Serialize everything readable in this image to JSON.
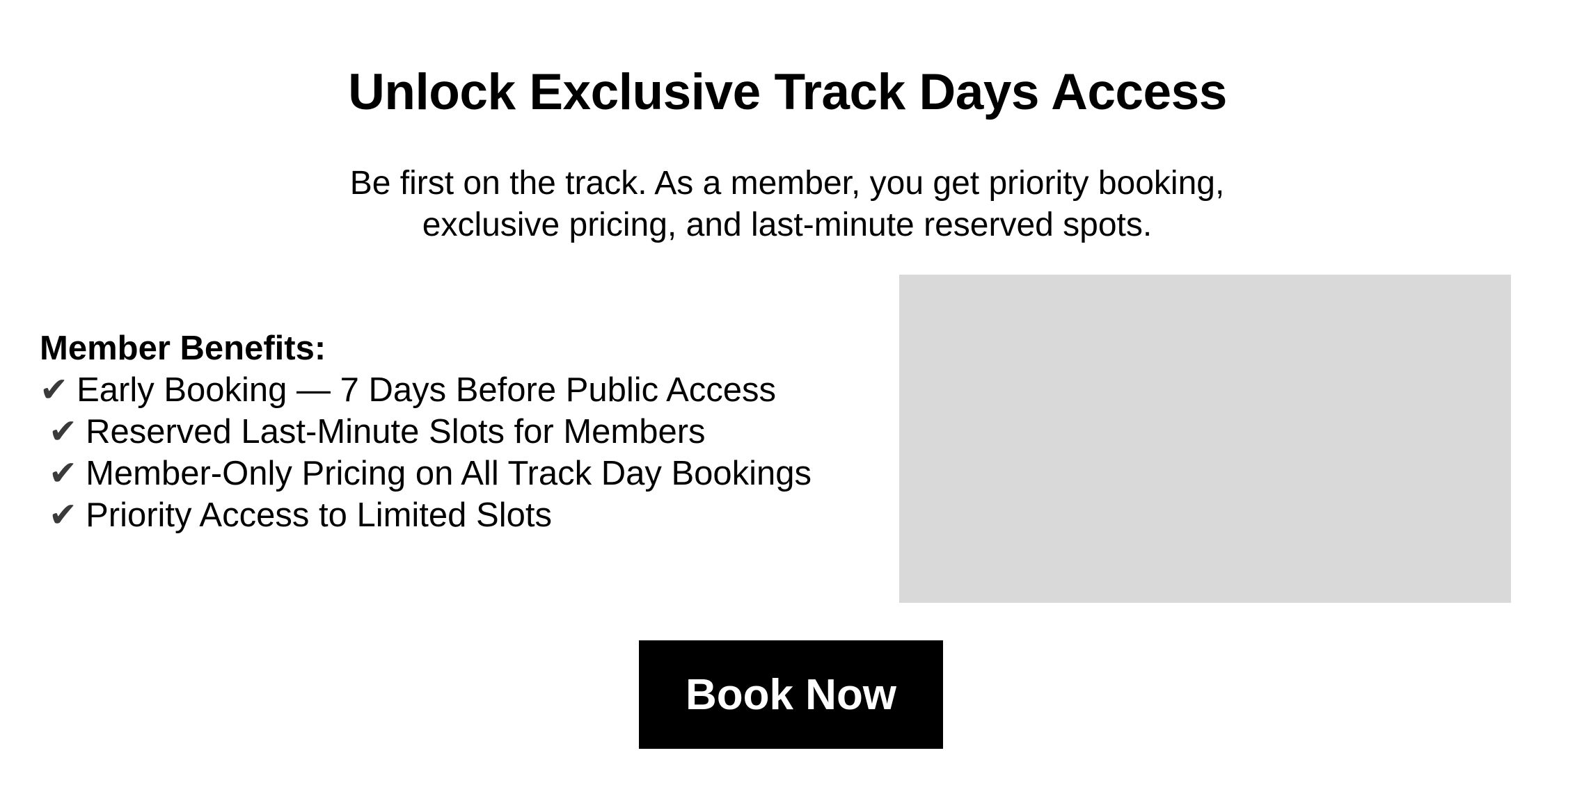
{
  "hero": {
    "title": "Unlock Exclusive Track Days Access",
    "subtitle_line1": "Be first on the track. As a member, you get priority booking,",
    "subtitle_line2": "exclusive pricing, and last-minute reserved spots."
  },
  "benefits": {
    "heading": "Member Benefits:",
    "check_glyph": "✔",
    "items": [
      {
        "label": "Early Booking — 7 Days Before Public Access"
      },
      {
        "label": "Reserved Last-Minute Slots for Members"
      },
      {
        "label": "Member-Only Pricing on All Track Day Bookings"
      },
      {
        "label": "Priority Access to Limited Slots"
      }
    ]
  },
  "media": {
    "placeholder_color": "#d9d9d9"
  },
  "cta": {
    "label": "Book Now",
    "background": "#000000",
    "text_color": "#ffffff"
  },
  "icons": {
    "check": "check-icon"
  }
}
